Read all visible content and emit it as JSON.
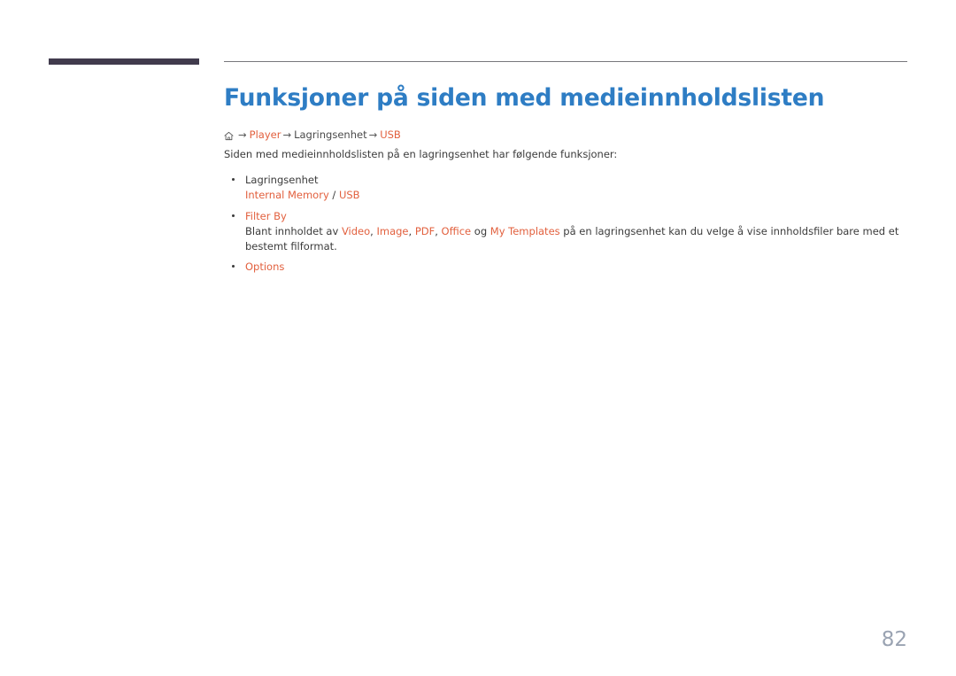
{
  "document": {
    "title": "Funksjoner på siden med medieinnholdslisten",
    "page_number": "82"
  },
  "colors": {
    "title_blue": "#2e7dc4",
    "accent_orange": "#e2603e",
    "body_gray": "#3b3b3b",
    "corner_bar": "#413b4d",
    "rule_gray": "#77787c",
    "page_number_gray": "#9aa3b2"
  },
  "breadcrumb": {
    "home_icon": "home-icon",
    "separator": "→",
    "items": [
      {
        "label": "Player",
        "style": "accent"
      },
      {
        "label": "Lagringsenhet",
        "style": "plain"
      },
      {
        "label": "USB",
        "style": "accent"
      }
    ]
  },
  "intro": {
    "text": "Siden med medieinnholdslisten på en lagringsenhet har følgende funksjoner:"
  },
  "bullets": [
    {
      "title": "Lagringsenhet",
      "title_style": "plain",
      "sub_tokens": [
        {
          "text": "Internal Memory",
          "style": "accent"
        },
        {
          "text": " / ",
          "style": "plain"
        },
        {
          "text": "USB",
          "style": "accent"
        }
      ]
    },
    {
      "title": "Filter By",
      "title_style": "accent",
      "sub_tokens": [
        {
          "text": "Blant innholdet av ",
          "style": "plain"
        },
        {
          "text": "Video",
          "style": "accent"
        },
        {
          "text": ", ",
          "style": "plain"
        },
        {
          "text": "Image",
          "style": "accent"
        },
        {
          "text": ", ",
          "style": "plain"
        },
        {
          "text": "PDF",
          "style": "accent"
        },
        {
          "text": ", ",
          "style": "plain"
        },
        {
          "text": "Office",
          "style": "accent"
        },
        {
          "text": " og ",
          "style": "plain"
        },
        {
          "text": "My Templates",
          "style": "accent"
        },
        {
          "text": " på en lagringsenhet kan du velge å vise innholdsfiler bare med et bestemt filformat.",
          "style": "plain"
        }
      ]
    },
    {
      "title": "Options",
      "title_style": "accent",
      "sub_tokens": []
    }
  ]
}
